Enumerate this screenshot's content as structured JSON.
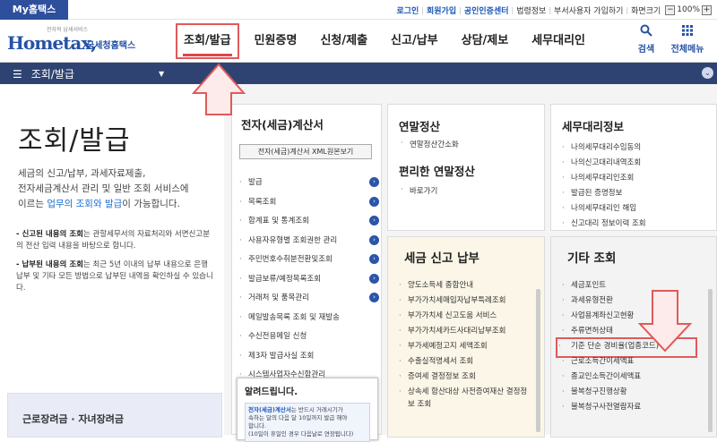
{
  "topbar": {
    "mytax": "My홈택스",
    "links": [
      "로그인",
      "회원가입",
      "공인인증센터",
      "법령정보",
      "부서사용자 가입하기",
      "화면크기"
    ],
    "zoom_minus": "−",
    "zoom": "100%",
    "zoom_plus": "+"
  },
  "header": {
    "logo_small": "전자적 납세서비스",
    "logo_brand": "Hometax,",
    "logo_korean": "국세청홈택스",
    "nav": [
      "조회/발급",
      "민원증명",
      "신청/제출",
      "신고/납부",
      "상담/제보",
      "세무대리인"
    ],
    "search_label": "검색",
    "menu_label": "전체메뉴"
  },
  "bar": {
    "title": "조회/발급",
    "dropdown": "▼",
    "collapse": "⌄"
  },
  "left": {
    "title": "조회/발급",
    "desc1": "세금의 신고/납부, 과세자료제출,",
    "desc2": "전자세금계산서 관리 및 일반 조회 서비스에",
    "desc3a": "이르는 ",
    "desc3b": "업무의 조회와 발급",
    "desc3c": "이 가능합니다.",
    "note1_bold": "- 신고된 내용의 조회",
    "note1_rest": "는 관할세무서의 자료처리와 서면신고분의 전산 입력 내용을 바탕으로 합니다.",
    "note2_bold": "- 납부된 내용의 조회",
    "note2_rest": "는 최근 5년 이내의 납부 내용으로 은행 납부 및 기타 모든 방법으로 납부된 내역을 확인하실 수 있습니다.",
    "welfare": "근로장려금 · 자녀장려금"
  },
  "col1": {
    "title": "전자(세금)계산서",
    "xml_button": "전자(세금)계산서 XML원본보기",
    "items": [
      {
        "label": "발급",
        "arrow": "›"
      },
      {
        "label": "목록조회",
        "arrow": "›"
      },
      {
        "label": "합계표 및 통계조회",
        "arrow": "›"
      },
      {
        "label": "사용자유형별 조회권한 관리",
        "arrow": "›"
      },
      {
        "label": "주민번호수취분전환및조회",
        "arrow": "›"
      },
      {
        "label": "발급보류/예정목록조회",
        "arrow": "›"
      },
      {
        "label": "거래처 및 품목관리",
        "arrow": "›"
      },
      {
        "label": "메일발송목록 조회 및 재발송",
        "arrow": ""
      },
      {
        "label": "수신전용메일 신청",
        "arrow": ""
      },
      {
        "label": "제3자 발급사실 조회",
        "arrow": ""
      },
      {
        "label": "시스템사업자수신함관리",
        "arrow": ""
      }
    ]
  },
  "alert": {
    "title": "알려드립니다.",
    "line1_hl": "전자(세금)계산서",
    "line1_rest": "는 반드시 거래시기가",
    "line2": "속하는 달의 다음 달 10일까지 발급 해야",
    "line3": "합니다.",
    "line4": "(10일이 휴일인 경우 다음날로 연장됩니다)"
  },
  "col2": {
    "title_a": "연말정산",
    "item_a": "연말정산간소화",
    "title_b": "편리한 연말정산",
    "item_b": "바로가기"
  },
  "col3": {
    "title": "세무대리정보",
    "items": [
      "나의세무대리수임동의",
      "나의신고대리내역조회",
      "나의세무대리인조회",
      "발급된 증명정보",
      "나의세무대리인 해임",
      "신고대리 정보이력 조회"
    ]
  },
  "col4": {
    "title": "세금 신고 납부",
    "items": [
      "양도소득세 종합안내",
      "부가가치세매입자납부특례조회",
      "부가가치세 신고도움 서비스",
      "부가가치세카드사대리납부조회",
      "부가세예정고지 세액조회",
      "수출실적명세서 조회",
      "증여세 결정정보 조회",
      "상속세 합산대상 사전증여재산 결정정보 조회"
    ]
  },
  "col5": {
    "title": "기타 조회",
    "items": [
      "세금포인트",
      "과세유형전환",
      "사업용계좌신고현황",
      "주류면허상태",
      "기준 단순 경비율(업종코드)",
      "근로소득간이세액표",
      "종교인소득간이세액표",
      "불복청구진행상황",
      "불복청구사전열람자료"
    ]
  },
  "colors": {
    "brand": "#2552a8",
    "bar": "#2e4371",
    "highlight": "#e05a5a"
  }
}
